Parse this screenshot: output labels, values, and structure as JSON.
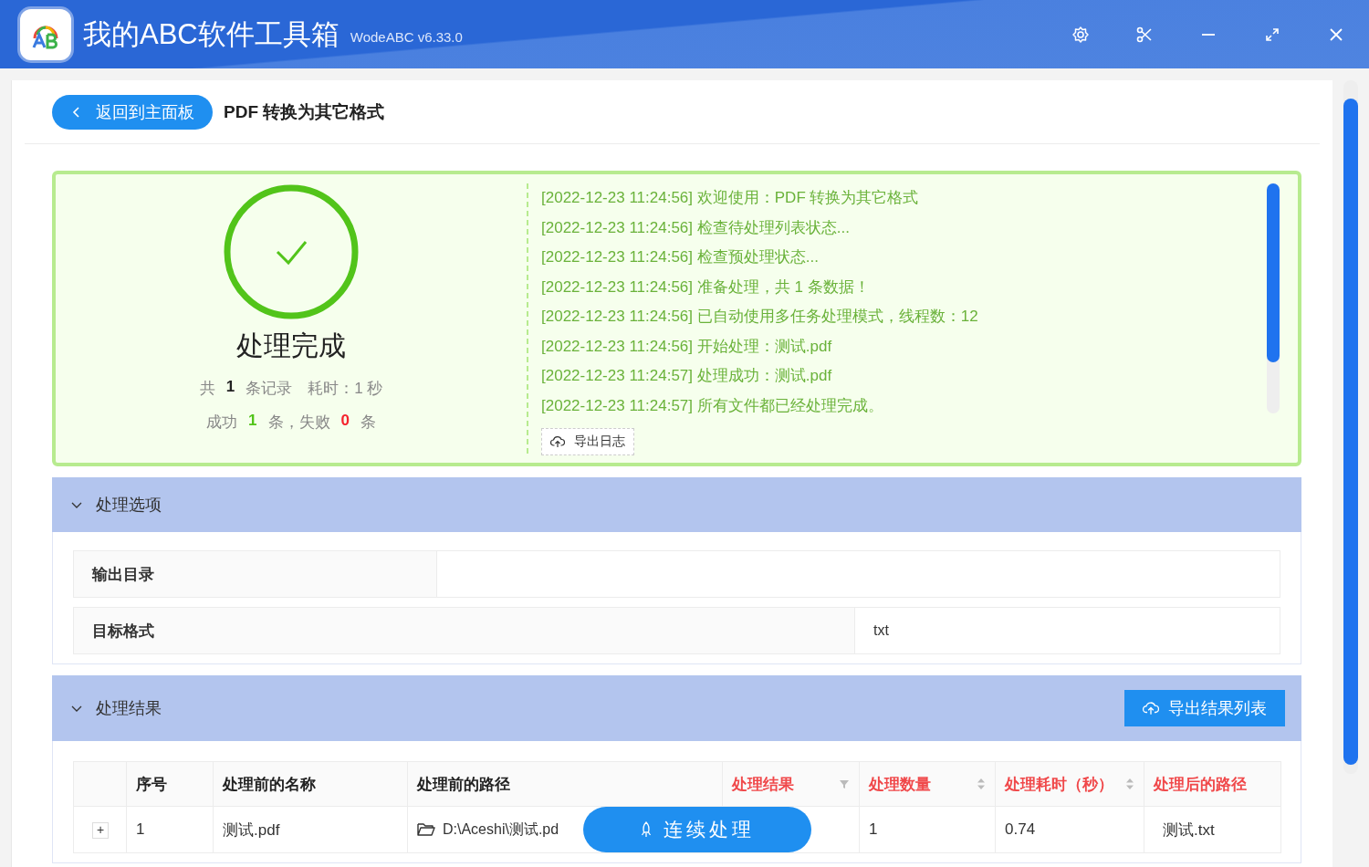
{
  "app": {
    "title": "我的ABC软件工具箱",
    "version": "WodeABC v6.33.0"
  },
  "page": {
    "back_button": "返回到主面板",
    "title": "PDF 转换为其它格式"
  },
  "summary": {
    "status": "处理完成",
    "lines": [
      {
        "parts": [
          {
            "kind": "plain",
            "text": "共"
          },
          {
            "kind": "count",
            "text": "1"
          },
          {
            "kind": "plain",
            "text": "条记录　耗时：1 秒"
          }
        ]
      },
      {
        "parts": [
          {
            "kind": "plain",
            "text": "成功"
          },
          {
            "kind": "success",
            "text": "1"
          },
          {
            "kind": "plain",
            "text": "条，失败"
          },
          {
            "kind": "fail",
            "text": "0"
          },
          {
            "kind": "plain",
            "text": "条"
          }
        ]
      }
    ]
  },
  "log": {
    "lines": [
      "[2022-12-23 11:24:56] 欢迎使用：PDF 转换为其它格式",
      "[2022-12-23 11:24:56] 检查待处理列表状态...",
      "[2022-12-23 11:24:56] 检查预处理状态...",
      "[2022-12-23 11:24:56] 准备处理，共 1 条数据！",
      "[2022-12-23 11:24:56] 已自动使用多任务处理模式，线程数：12",
      "[2022-12-23 11:24:56] 开始处理：测试.pdf",
      "[2022-12-23 11:24:57] 处理成功：测试.pdf",
      "[2022-12-23 11:24:57] 所有文件都已经处理完成。"
    ],
    "export_button": "导出日志"
  },
  "options": {
    "title": "处理选项",
    "expanded": true,
    "fields": [
      {
        "label": "输出目录"
      },
      {
        "label": "目标格式",
        "value": "txt"
      }
    ]
  },
  "results": {
    "title": "处理结果",
    "expanded": true,
    "export_button": "导出结果列表",
    "columns": [
      {
        "kind": "plain",
        "highlighted": false
      },
      {
        "label": "序号",
        "kind": "plain",
        "highlighted": false
      },
      {
        "label": "处理前的名称",
        "kind": "plain",
        "highlighted": false
      },
      {
        "label": "处理前的路径",
        "kind": "plain",
        "highlighted": false
      },
      {
        "label": "处理结果",
        "kind": "filter",
        "highlighted": true
      },
      {
        "label": "处理数量",
        "kind": "sortable",
        "highlighted": true
      },
      {
        "label": "处理耗时（秒）",
        "kind": "sortable",
        "highlighted": true
      },
      {
        "label": "处理后的路径",
        "kind": "plain",
        "highlighted": true
      }
    ],
    "rows": [
      {
        "expander": "+",
        "index": "1",
        "name": "测试.pdf",
        "path": "D:\\Aceshi\\测试.pd",
        "count": "1",
        "time": "0.74",
        "output": "测试.txt"
      }
    ]
  },
  "continue_button": "连续处理"
}
